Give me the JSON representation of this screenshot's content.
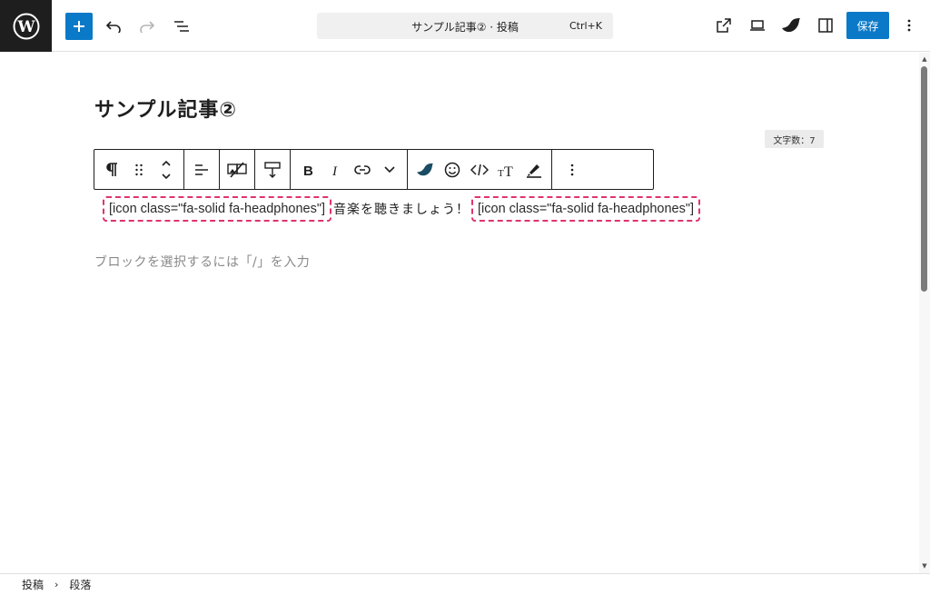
{
  "topbar": {
    "command_title": "サンプル記事② · 投稿",
    "command_shortcut": "Ctrl+K",
    "save_label": "保存"
  },
  "editor": {
    "post_title": "サンプル記事②",
    "char_count": "文字数：7",
    "paragraph": {
      "shortcode_left": "[icon class=\"fa-solid fa-headphones\"]",
      "text": "音楽を聴きましょう！",
      "shortcode_right": "[icon class=\"fa-solid fa-headphones\"]"
    },
    "placeholder": "ブロックを選択するには「/」を入力"
  },
  "toolbar_icons": [
    "pilcrow-icon",
    "drag-handle-icon",
    "move-up-down-icon",
    "align-left-icon",
    "image-off-icon",
    "spacing-icon",
    "bold-icon",
    "italic-icon",
    "link-icon",
    "chevron-down-icon",
    "leaf-icon",
    "emoji-icon",
    "code-icon",
    "text-size-icon",
    "highlighter-icon",
    "more-options-icon"
  ],
  "footer": {
    "crumbs": [
      "投稿",
      "段落"
    ]
  },
  "colors": {
    "accent": "#0a79c8",
    "shortcode_border": "#e0336f",
    "logo_bg": "#1e1e1e"
  }
}
